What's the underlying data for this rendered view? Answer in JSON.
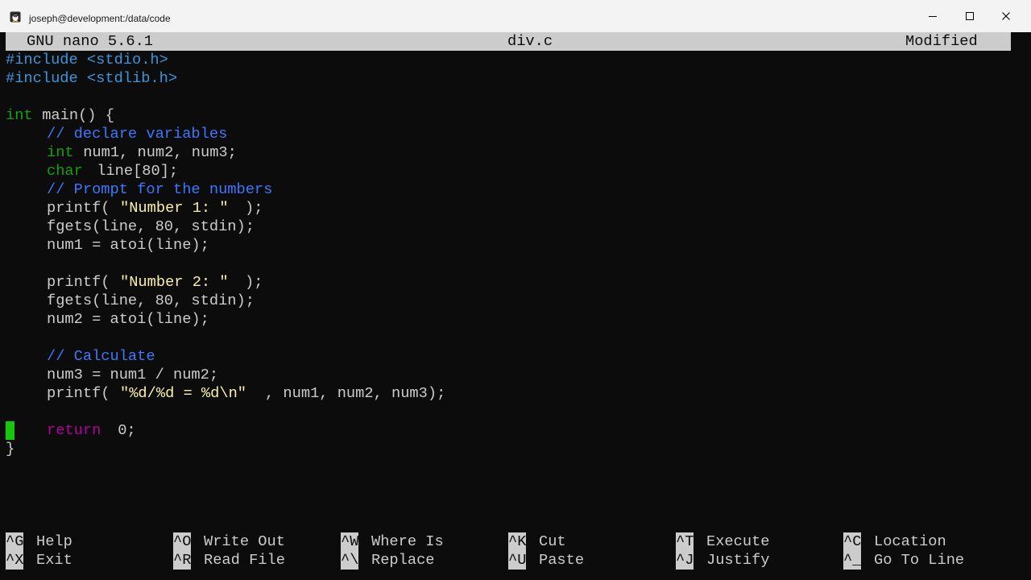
{
  "window": {
    "title": "joseph@development:/data/code",
    "icon": "tux-terminal-icon"
  },
  "header": {
    "app": "GNU nano 5.6.1",
    "filename": "div.c",
    "status": "Modified"
  },
  "code": {
    "l1": "#include <stdio.h>",
    "l2": "#include <stdlib.h>",
    "l4_type": "int",
    "l4_rest": " main() {",
    "l5": "// declare variables",
    "l6_type": "int",
    "l6_rest": " num1, num2, num3;",
    "l7_type": "char",
    "l7_rest": " line[80];",
    "l8": "// Prompt for the numbers",
    "l9_a": "printf(",
    "l9_s": "\"Number 1: \"",
    "l9_b": ");",
    "l10": "fgets(line, 80, stdin);",
    "l11": "num1 = atoi(line);",
    "l13_a": "printf(",
    "l13_s": "\"Number 2: \"",
    "l13_b": ");",
    "l14": "fgets(line, 80, stdin);",
    "l15": "num2 = atoi(line);",
    "l17": "// Calculate",
    "l18": "num3 = num1 / num2;",
    "l19_a": "printf(",
    "l19_s": "\"%d/%d = %d\\n\"",
    "l19_b": ", num1, num2, num3);",
    "l21_kw": "return",
    "l21_rest": " 0;",
    "l22": "}"
  },
  "shortcuts": [
    {
      "key": "^G",
      "label": "Help"
    },
    {
      "key": "^O",
      "label": "Write Out"
    },
    {
      "key": "^W",
      "label": "Where Is"
    },
    {
      "key": "^K",
      "label": "Cut"
    },
    {
      "key": "^T",
      "label": "Execute"
    },
    {
      "key": "^C",
      "label": "Location"
    },
    {
      "key": "^X",
      "label": "Exit"
    },
    {
      "key": "^R",
      "label": "Read File"
    },
    {
      "key": "^\\",
      "label": "Replace"
    },
    {
      "key": "^U",
      "label": "Paste"
    },
    {
      "key": "^J",
      "label": "Justify"
    },
    {
      "key": "^_",
      "label": "Go To Line"
    }
  ],
  "colors": {
    "background": "#0c0c0c",
    "foreground": "#cccccc",
    "preprocessor": "#3a96dd",
    "type": "#13a10e",
    "comment": "#3b78ff",
    "string": "#f9f1a5",
    "keyword": "#b4009e",
    "cursor": "#16c60c"
  }
}
